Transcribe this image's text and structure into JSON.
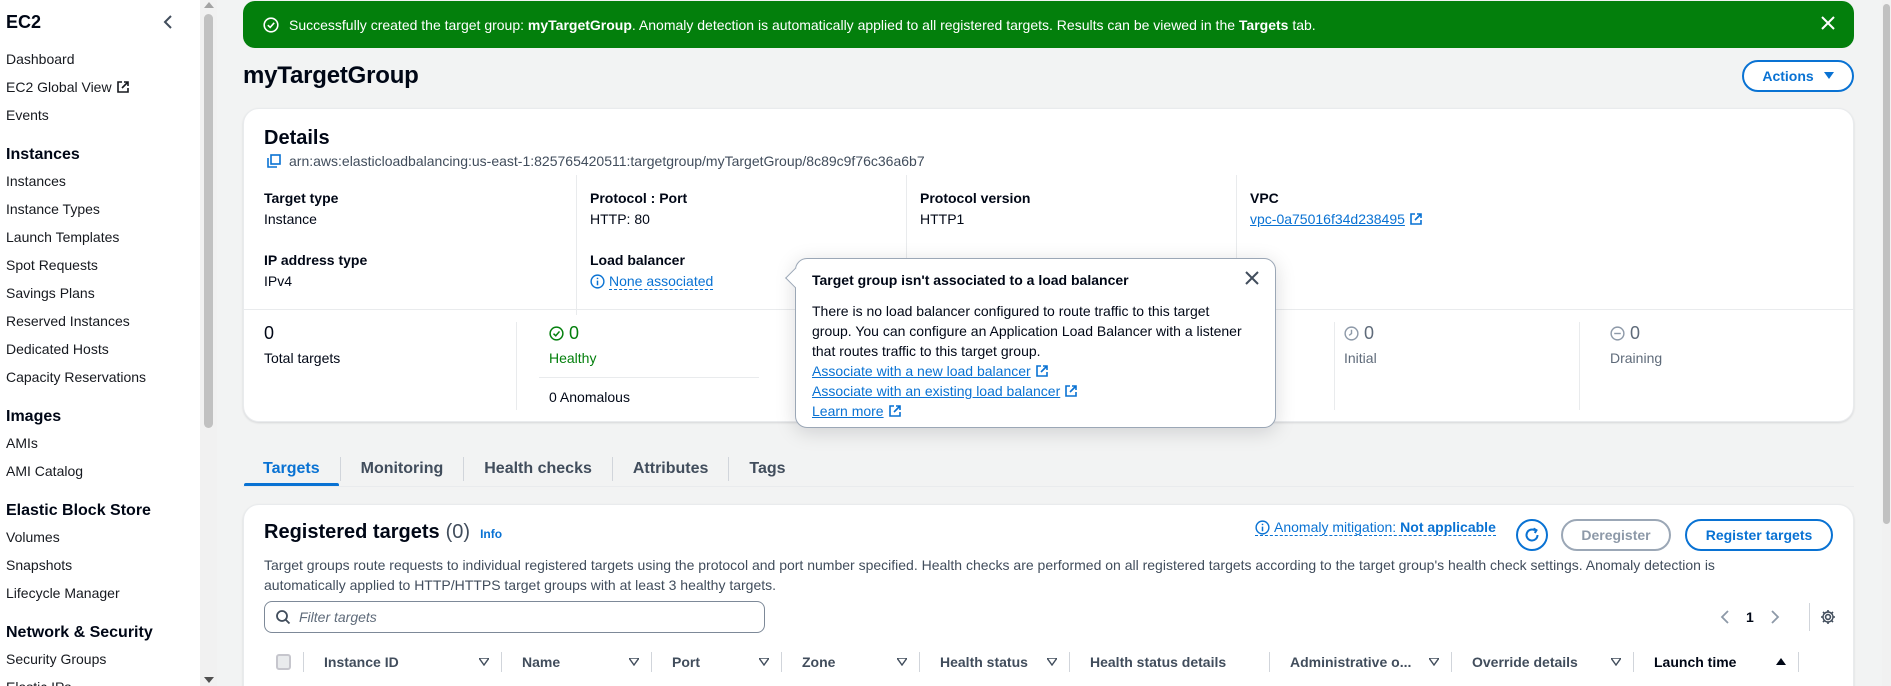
{
  "sidebar": {
    "title": "EC2",
    "items_top": [
      {
        "label": "Dashboard"
      },
      {
        "label": "EC2 Global View",
        "external": true
      },
      {
        "label": "Events"
      }
    ],
    "sections": [
      {
        "title": "Instances",
        "items": [
          "Instances",
          "Instance Types",
          "Launch Templates",
          "Spot Requests",
          "Savings Plans",
          "Reserved Instances",
          "Dedicated Hosts",
          "Capacity Reservations"
        ]
      },
      {
        "title": "Images",
        "items": [
          "AMIs",
          "AMI Catalog"
        ]
      },
      {
        "title": "Elastic Block Store",
        "items": [
          "Volumes",
          "Snapshots",
          "Lifecycle Manager"
        ]
      },
      {
        "title": "Network & Security",
        "items": [
          "Security Groups",
          "Elastic IPs"
        ]
      }
    ]
  },
  "flash": {
    "prefix": "Successfully created the target group: ",
    "group": "myTargetGroup",
    "middle": ". Anomaly detection is automatically applied to all registered targets. Results can be viewed in the ",
    "tab": "Targets",
    "suffix": " tab.",
    "color": "#037f0c"
  },
  "header": {
    "title": "myTargetGroup",
    "actions_label": "Actions"
  },
  "details": {
    "title": "Details",
    "arn": "arn:aws:elasticloadbalancing:us-east-1:825765420511:targetgroup/myTargetGroup/8c89c9f76c36a6b7",
    "target_type_label": "Target type",
    "target_type_value": "Instance",
    "protocol_port_label": "Protocol : Port",
    "protocol_port_value": "HTTP: 80",
    "protocol_version_label": "Protocol version",
    "protocol_version_value": "HTTP1",
    "vpc_label": "VPC",
    "vpc_value": "vpc-0a75016f34d238495",
    "ip_type_label": "IP address type",
    "ip_type_value": "IPv4",
    "lb_label": "Load balancer",
    "lb_value": "None associated",
    "stats": {
      "total_value": "0",
      "total_label": "Total targets",
      "healthy_value": "0",
      "healthy_label": "Healthy",
      "anomalous_label": "0 Anomalous",
      "initial_value": "0",
      "initial_label": "Initial",
      "draining_value": "0",
      "draining_label": "Draining"
    }
  },
  "popover": {
    "title": "Target group isn't associated to a load balancer",
    "body": "There is no load balancer configured to route traffic to this target group. You can configure an Application Load Balancer with a listener that routes traffic to this target group.",
    "link1": "Associate with a new load balancer",
    "link2": "Associate with an existing load balancer",
    "link3": "Learn more"
  },
  "tabs": [
    "Targets",
    "Monitoring",
    "Health checks",
    "Attributes",
    "Tags"
  ],
  "registered": {
    "title": "Registered targets",
    "count": "(0)",
    "info": "Info",
    "anomaly_prefix": "Anomaly mitigation: ",
    "anomaly_value": "Not applicable",
    "deregister_label": "Deregister",
    "register_label": "Register targets",
    "description": "Target groups route requests to individual registered targets using the protocol and port number specified. Health checks are performed on all registered targets according to the target group's health check settings. Anomaly detection is automatically applied to HTTP/HTTPS target groups with at least 3 healthy targets.",
    "filter_placeholder": "Filter targets",
    "page": "1",
    "columns": [
      "Instance ID",
      "Name",
      "Port",
      "Zone",
      "Health status",
      "Health status details",
      "Administrative o...",
      "Override details",
      "Launch time"
    ]
  }
}
